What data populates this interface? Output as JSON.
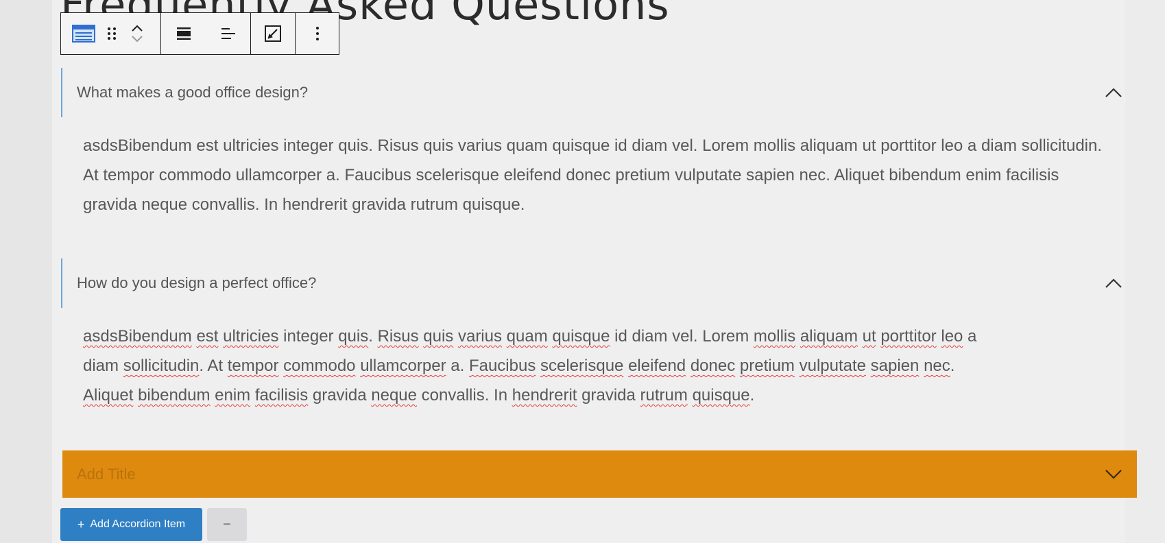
{
  "page": {
    "title": "Frequently Asked Questions"
  },
  "toolbar": {
    "block_type_icon": "accordion-block-icon",
    "drag_icon": "drag-handle-icon",
    "move_icon": "move-up-down-icon",
    "align_icon": "align-center-icon",
    "text_align_icon": "text-align-left-icon",
    "edit_icon": "edit-square-icon",
    "more_icon": "more-options-icon"
  },
  "accordion": {
    "items": [
      {
        "title": "What makes a good office design?",
        "body": "asdsBibendum est ultricies integer quis. Risus quis varius quam quisque id diam vel. Lorem mollis aliquam ut porttitor leo a diam sollicitudin. At tempor commodo ullamcorper a. Faucibus scelerisque eleifend donec pretium vulputate sapien nec. Aliquet bibendum enim facilisis gravida neque convallis. In hendrerit gravida rutrum quisque.",
        "expanded": true
      },
      {
        "title": "How do you design a perfect office?",
        "body_line1_parts": [
          "asdsBibendum",
          " ",
          "est",
          " ",
          "ultricies",
          " integer ",
          "quis",
          ". ",
          "Risus",
          " ",
          "quis",
          " ",
          "varius",
          " ",
          "quam",
          " ",
          "quisque",
          " id diam vel. Lorem ",
          "mollis",
          " ",
          "aliquam",
          " ",
          "ut",
          " ",
          "porttitor",
          " ",
          "leo",
          " a"
        ],
        "body_line2_parts": [
          "diam ",
          "sollicitudin",
          ". At ",
          "tempor",
          " ",
          "commodo",
          " ",
          "ullamcorper",
          " a. ",
          "Faucibus",
          " ",
          "scelerisque",
          " ",
          "eleifend",
          " ",
          "donec",
          " ",
          "pretium",
          " ",
          "vulputate",
          " ",
          "sapien",
          " ",
          "nec",
          "."
        ],
        "body_line3_parts": [
          "Aliquet",
          " ",
          "bibendum",
          " ",
          "enim",
          " ",
          "facilisis",
          " gravida ",
          "neque",
          " convallis. In ",
          "hendrerit",
          " gravida ",
          "rutrum",
          " ",
          "quisque",
          "."
        ],
        "expanded": true
      },
      {
        "title_placeholder": "Add Title",
        "expanded": false
      }
    ],
    "accent_color": "#de8a0f",
    "border_color": "#6ea6d6"
  },
  "actions": {
    "add_label": "Add Accordion Item",
    "remove_label": "−",
    "add_color": "#2f7fc4"
  }
}
